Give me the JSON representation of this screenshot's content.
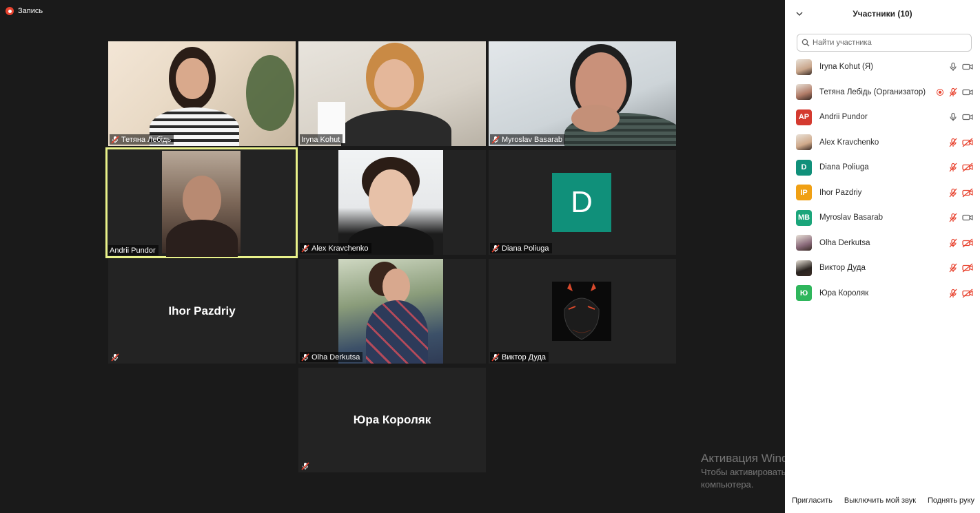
{
  "recording": {
    "label": "Запись"
  },
  "tiles": [
    {
      "name": "Тетяна Лебідь",
      "muted": true
    },
    {
      "name": "Iryna Kohut",
      "muted": false
    },
    {
      "name": "Myroslav Basarab",
      "muted": true
    },
    {
      "name": "Andrii Pundor",
      "muted": false,
      "active": true
    },
    {
      "name": "Alex Kravchenko",
      "muted": true
    },
    {
      "name": "Diana Poliuga",
      "muted": true,
      "avatar_letter": "D",
      "avatar_color": "#10907a"
    },
    {
      "name": "Ihor Pazdriy",
      "muted": true,
      "name_only": true
    },
    {
      "name": "Olha Derkutsa",
      "muted": true
    },
    {
      "name": "Виктор Дуда",
      "muted": true
    },
    {
      "name": "Юра Короляк",
      "muted": true,
      "name_only": true
    }
  ],
  "panel": {
    "title": "Участники (10)",
    "search_placeholder": "Найти участника",
    "participants": [
      {
        "name": "Iryna Kohut (Я)",
        "avatar": "photo",
        "mic": "on",
        "video": "on"
      },
      {
        "name": "Тетяна Лебідь (Организатор)",
        "avatar": "photo",
        "recording": true,
        "mic": "muted",
        "video": "on"
      },
      {
        "name": "Andrii Pundor",
        "avatar_initials": "AP",
        "avatar_color": "#d43a2f",
        "mic": "on",
        "video": "on"
      },
      {
        "name": "Alex Kravchenko",
        "avatar": "photo",
        "mic": "muted",
        "video": "off"
      },
      {
        "name": "Diana Poliuga",
        "avatar_initials": "D",
        "avatar_color": "#10907a",
        "mic": "muted",
        "video": "off"
      },
      {
        "name": "Ihor Pazdriy",
        "avatar_initials": "IP",
        "avatar_color": "#f0a014",
        "mic": "muted",
        "video": "off"
      },
      {
        "name": "Myroslav Basarab",
        "avatar_initials": "MB",
        "avatar_color": "#1aa57a",
        "mic": "muted",
        "video": "on"
      },
      {
        "name": "Olha Derkutsa",
        "avatar": "photo",
        "mic": "muted",
        "video": "off"
      },
      {
        "name": "Виктор Дуда",
        "avatar": "photo",
        "mic": "muted",
        "video": "off"
      },
      {
        "name": "Юра Короляк",
        "avatar_initials": "Ю",
        "avatar_color": "#2fb65c",
        "mic": "muted",
        "video": "off"
      }
    ],
    "footer": {
      "invite": "Пригласить",
      "unmute": "Выключить мой звук",
      "raise_hand": "Поднять руку"
    }
  },
  "watermark": {
    "title": "Активация Windows",
    "line1": "Чтобы активировать Windows, перейдите к параметрам",
    "line2": "компьютера."
  },
  "colors": {
    "active_border": "#e9f28a",
    "muted_red": "#e8432f",
    "panel_bg": "#ffffff",
    "stage_bg": "#1a1a1a"
  }
}
